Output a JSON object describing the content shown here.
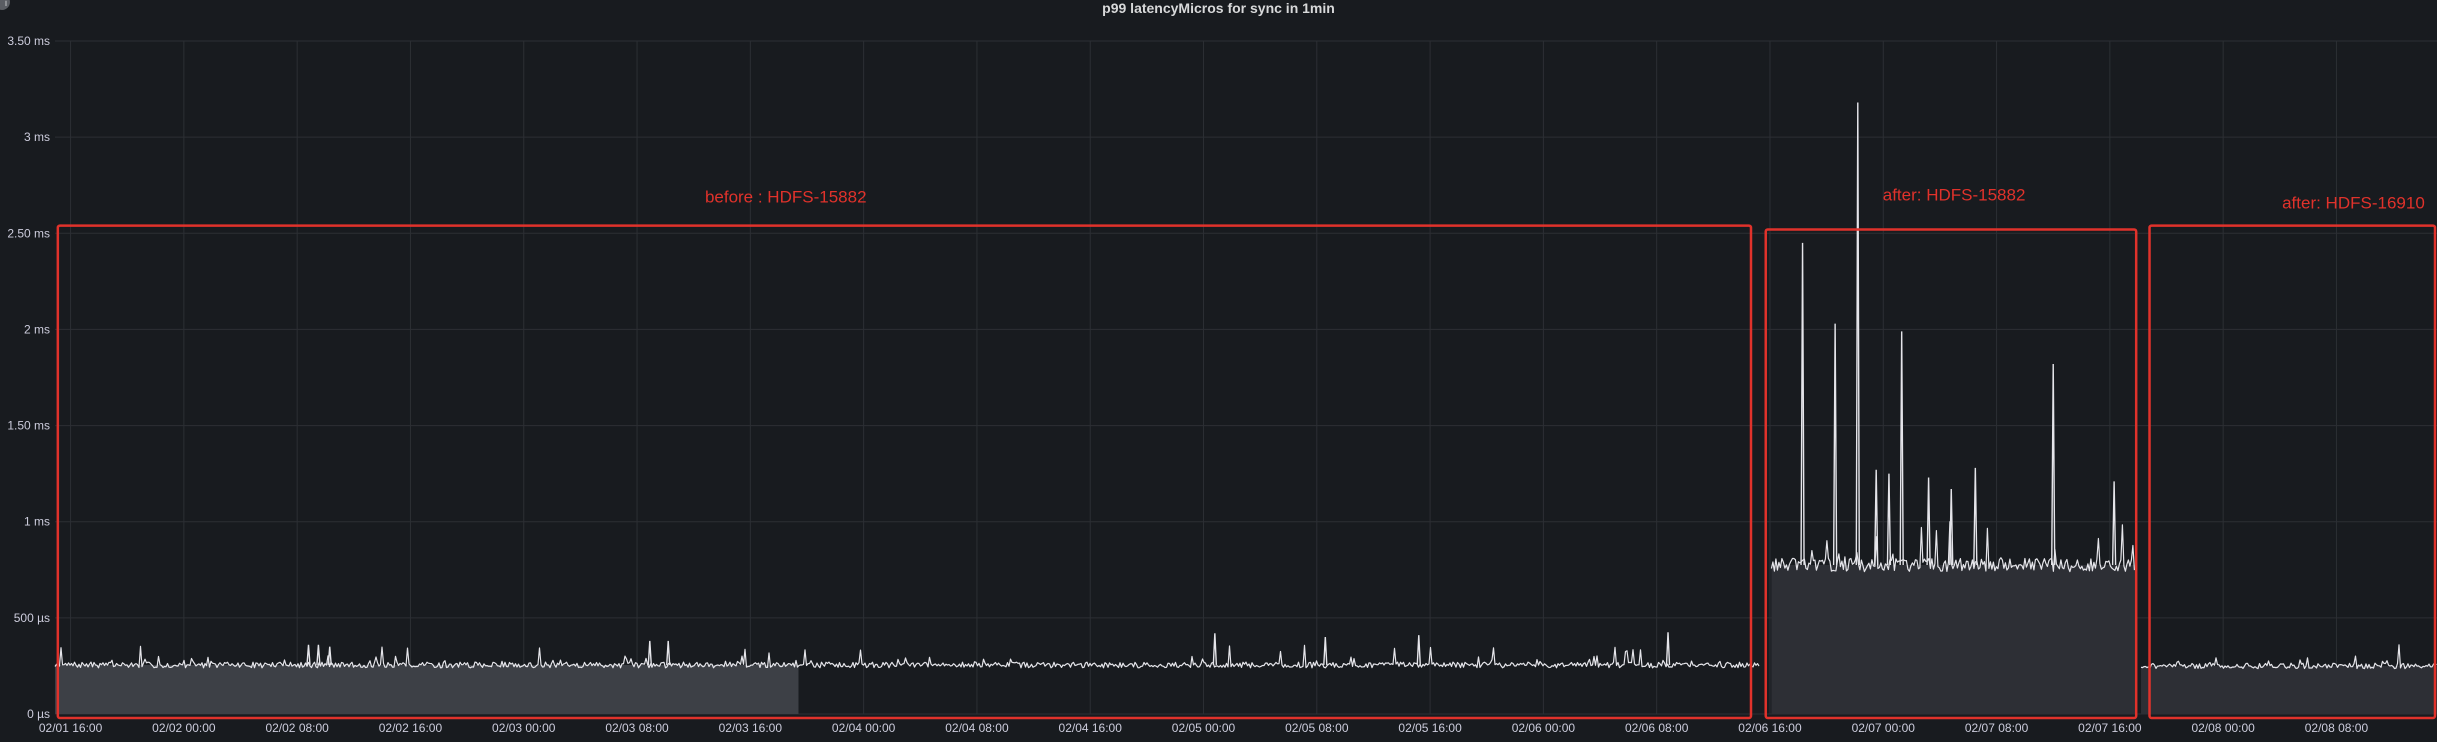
{
  "panel": {
    "title": "p99 latencyMicros for sync in 1min",
    "corner_icon": "info-icon",
    "corner_glyph": "i"
  },
  "colors": {
    "background": "#181b1f",
    "grid": "#2c2f34",
    "axis_text": "#ccccdc",
    "series_line": "#e5e5ea",
    "fill_before": "#3d4046",
    "fill_after": "#2d2f35",
    "annotation_red": "#e0322b"
  },
  "chart_data": {
    "type": "line",
    "title": "p99 latencyMicros for sync in 1min",
    "xlabel": "",
    "ylabel": "",
    "y_unit": "µs",
    "ylim": [
      0,
      3500
    ],
    "y_ticks": [
      {
        "value": 0,
        "label": "0 µs"
      },
      {
        "value": 500,
        "label": "500 µs"
      },
      {
        "value": 1000,
        "label": "1 ms"
      },
      {
        "value": 1500,
        "label": "1.50 ms"
      },
      {
        "value": 2000,
        "label": "2 ms"
      },
      {
        "value": 2500,
        "label": "2.50 ms"
      },
      {
        "value": 3000,
        "label": "3 ms"
      },
      {
        "value": 3500,
        "label": "3.50 ms"
      }
    ],
    "x_ticks": [
      {
        "hour": 0,
        "label": "02/01 16:00"
      },
      {
        "hour": 8,
        "label": "02/02 00:00"
      },
      {
        "hour": 16,
        "label": "02/02 08:00"
      },
      {
        "hour": 24,
        "label": "02/02 16:00"
      },
      {
        "hour": 32,
        "label": "02/03 00:00"
      },
      {
        "hour": 40,
        "label": "02/03 08:00"
      },
      {
        "hour": 48,
        "label": "02/03 16:00"
      },
      {
        "hour": 56,
        "label": "02/04 00:00"
      },
      {
        "hour": 64,
        "label": "02/04 08:00"
      },
      {
        "hour": 72,
        "label": "02/04 16:00"
      },
      {
        "hour": 80,
        "label": "02/05 00:00"
      },
      {
        "hour": 88,
        "label": "02/05 08:00"
      },
      {
        "hour": 96,
        "label": "02/05 16:00"
      },
      {
        "hour": 104,
        "label": "02/06 00:00"
      },
      {
        "hour": 112,
        "label": "02/06 08:00"
      },
      {
        "hour": 120,
        "label": "02/06 16:00"
      },
      {
        "hour": 128,
        "label": "02/07 00:00"
      },
      {
        "hour": 136,
        "label": "02/07 08:00"
      },
      {
        "hour": 144,
        "label": "02/07 16:00"
      },
      {
        "hour": 152,
        "label": "02/08 00:00"
      },
      {
        "hour": 160,
        "label": "02/08 08:00"
      }
    ],
    "x_range_hours": [
      -1.1,
      167.1
    ],
    "grid": true,
    "legend": "none",
    "segments": [
      {
        "start": -1.1,
        "end": 119.3,
        "baseline": 255,
        "noise": 15,
        "seed": 7
      },
      {
        "start": 120.1,
        "end": 145.8,
        "baseline": 775,
        "noise": 35,
        "seed": 13
      },
      {
        "start": 146.2,
        "end": 167.1,
        "baseline": 250,
        "noise": 14,
        "seed": 21
      }
    ],
    "peaks": [
      {
        "x": 16.8,
        "y": 360
      },
      {
        "x": 17.5,
        "y": 360
      },
      {
        "x": 18.3,
        "y": 350
      },
      {
        "x": 40.9,
        "y": 380
      },
      {
        "x": 42.2,
        "y": 380
      },
      {
        "x": 80.8,
        "y": 420
      },
      {
        "x": 88.6,
        "y": 400
      },
      {
        "x": 95.2,
        "y": 410
      },
      {
        "x": 112.8,
        "y": 425
      },
      {
        "x": 122.3,
        "y": 2450
      },
      {
        "x": 124.6,
        "y": 2030
      },
      {
        "x": 126.2,
        "y": 3180
      },
      {
        "x": 127.5,
        "y": 1270
      },
      {
        "x": 128.4,
        "y": 1250
      },
      {
        "x": 129.3,
        "y": 1990
      },
      {
        "x": 131.2,
        "y": 1230
      },
      {
        "x": 132.8,
        "y": 1170
      },
      {
        "x": 134.5,
        "y": 1280
      },
      {
        "x": 140.0,
        "y": 1820
      },
      {
        "x": 144.3,
        "y": 1210
      }
    ],
    "area_bands": [
      {
        "start": -1.1,
        "end": 51.4,
        "level": 255,
        "color": "#3d4046"
      },
      {
        "start": 120.1,
        "end": 145.8,
        "level": 775,
        "color": "#2d2f35"
      },
      {
        "start": 146.2,
        "end": 167.1,
        "level": 250,
        "color": "#2d2f35"
      }
    ],
    "annotations": [
      {
        "label": "before : HDFS-15882",
        "start": -0.9,
        "end": 118.8,
        "top": 2540,
        "label_x": 50.5,
        "label_y": 2660
      },
      {
        "label": "after: HDFS-15882",
        "start": 119.7,
        "end": 146.0,
        "top": 2520,
        "label_x": 133.0,
        "label_y": 2670
      },
      {
        "label": "after: HDFS-16910",
        "start": 146.8,
        "end": 167.1,
        "top": 2540,
        "label_x": 161.2,
        "label_y": 2630
      }
    ]
  }
}
